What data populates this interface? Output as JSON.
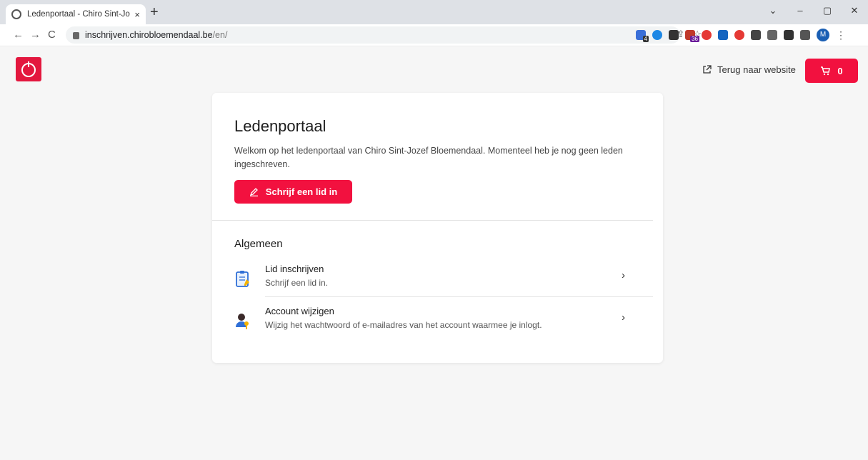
{
  "browser": {
    "tab_title": "Ledenportaal - Chiro Sint-Jozef B",
    "tab_close": "×",
    "new_tab": "+",
    "url_host": "inschrijven.chirobloemendaal.be",
    "url_path": "/en/",
    "profile_initial": "M",
    "window_controls": {
      "minimize": "–",
      "maximize": "▢",
      "close": "✕",
      "dropdown": "⌄"
    },
    "nav": {
      "back": "←",
      "forward": "→",
      "reload": "C"
    },
    "omnibox_icons": {
      "share": "⇪",
      "star": "☆"
    },
    "extension_badge_1": "4",
    "extension_badge_2": "36",
    "menu": "⋮"
  },
  "header": {
    "back_link_icon": "external-link-icon",
    "back_link_label": "Terug naar website",
    "cart_count": "0",
    "accent_color": "#f2113f"
  },
  "portal": {
    "title": "Ledenportaal",
    "intro": "Welkom op het ledenportaal van Chiro Sint-Jozef Bloemendaal. Momenteel heb je nog geen leden ingeschreven.",
    "primary_button_label": "Schrijf een lid in",
    "section_title": "Algemeen",
    "items": [
      {
        "title": "Lid inschrijven",
        "subtitle": "Schrijf een lid in.",
        "icon": "clipboard-icon"
      },
      {
        "title": "Account wijzigen",
        "subtitle": "Wijzig het wachtwoord of e-mailadres van het account waarmee je inlogt.",
        "icon": "user-key-icon"
      }
    ],
    "chevron": "›"
  }
}
